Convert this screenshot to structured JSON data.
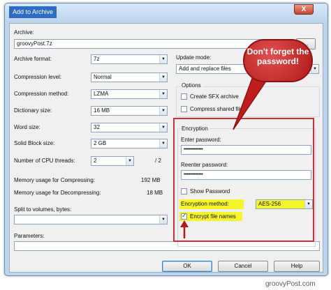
{
  "window": {
    "title": "Add to Archive",
    "close_symbol": "X"
  },
  "archive": {
    "label": "Archive:",
    "value": "groovyPost.7z"
  },
  "format": {
    "archive_format": {
      "label": "Archive format:",
      "value": "7z"
    },
    "compression_level": {
      "label": "Compression level:",
      "value": "Normal"
    },
    "compression_method": {
      "label": "Compression method:",
      "value": "LZMA"
    },
    "dictionary_size": {
      "label": "Dictionary size:",
      "value": "16 MB"
    },
    "word_size": {
      "label": "Word size:",
      "value": "32"
    },
    "solid_block_size": {
      "label": "Solid Block size:",
      "value": "2 GB"
    },
    "cpu_threads": {
      "label": "Number of CPU threads:",
      "value": "2",
      "total": "/ 2"
    }
  },
  "memory": {
    "compressing": {
      "label": "Memory usage for Compressing:",
      "value": "192 MB"
    },
    "decompressing": {
      "label": "Memory usage for Decompressing:",
      "value": "18 MB"
    }
  },
  "split": {
    "label": "Split to volumes, bytes:",
    "value": ""
  },
  "parameters": {
    "label": "Parameters:",
    "value": ""
  },
  "update_mode": {
    "label": "Update mode:",
    "value": "Add and replace files"
  },
  "options": {
    "label": "Options",
    "create_sfx": {
      "label": "Create SFX archive",
      "checked": false
    },
    "compress_shared": {
      "label": "Compress shared files",
      "checked": false
    }
  },
  "encryption": {
    "label": "Encryption",
    "enter_password": {
      "label": "Enter password:",
      "value": "••••••••••••••"
    },
    "reenter_password": {
      "label": "Reenter password:",
      "value": "••••••••••••••"
    },
    "show_password": {
      "label": "Show Password",
      "checked": false
    },
    "method": {
      "label": "Encryption method:",
      "value": "AES-256"
    },
    "encrypt_names": {
      "label": "Encrypt file names",
      "checked": true
    }
  },
  "buttons": {
    "ok": "OK",
    "cancel": "Cancel",
    "help": "Help"
  },
  "annotation": {
    "callout_text": "Don't forget the password!",
    "highlight_color": "#f5f52a",
    "callout_color": "#c01e1e",
    "box_color": "#c8323a"
  },
  "watermark": "groovyPost.com"
}
